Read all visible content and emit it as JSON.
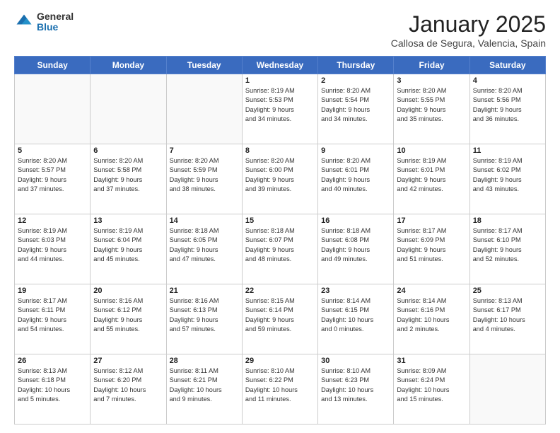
{
  "header": {
    "logo_general": "General",
    "logo_blue": "Blue",
    "month_title": "January 2025",
    "location": "Callosa de Segura, Valencia, Spain"
  },
  "days_of_week": [
    "Sunday",
    "Monday",
    "Tuesday",
    "Wednesday",
    "Thursday",
    "Friday",
    "Saturday"
  ],
  "weeks": [
    [
      {
        "day": "",
        "info": ""
      },
      {
        "day": "",
        "info": ""
      },
      {
        "day": "",
        "info": ""
      },
      {
        "day": "1",
        "info": "Sunrise: 8:19 AM\nSunset: 5:53 PM\nDaylight: 9 hours\nand 34 minutes."
      },
      {
        "day": "2",
        "info": "Sunrise: 8:20 AM\nSunset: 5:54 PM\nDaylight: 9 hours\nand 34 minutes."
      },
      {
        "day": "3",
        "info": "Sunrise: 8:20 AM\nSunset: 5:55 PM\nDaylight: 9 hours\nand 35 minutes."
      },
      {
        "day": "4",
        "info": "Sunrise: 8:20 AM\nSunset: 5:56 PM\nDaylight: 9 hours\nand 36 minutes."
      }
    ],
    [
      {
        "day": "5",
        "info": "Sunrise: 8:20 AM\nSunset: 5:57 PM\nDaylight: 9 hours\nand 37 minutes."
      },
      {
        "day": "6",
        "info": "Sunrise: 8:20 AM\nSunset: 5:58 PM\nDaylight: 9 hours\nand 37 minutes."
      },
      {
        "day": "7",
        "info": "Sunrise: 8:20 AM\nSunset: 5:59 PM\nDaylight: 9 hours\nand 38 minutes."
      },
      {
        "day": "8",
        "info": "Sunrise: 8:20 AM\nSunset: 6:00 PM\nDaylight: 9 hours\nand 39 minutes."
      },
      {
        "day": "9",
        "info": "Sunrise: 8:20 AM\nSunset: 6:01 PM\nDaylight: 9 hours\nand 40 minutes."
      },
      {
        "day": "10",
        "info": "Sunrise: 8:19 AM\nSunset: 6:01 PM\nDaylight: 9 hours\nand 42 minutes."
      },
      {
        "day": "11",
        "info": "Sunrise: 8:19 AM\nSunset: 6:02 PM\nDaylight: 9 hours\nand 43 minutes."
      }
    ],
    [
      {
        "day": "12",
        "info": "Sunrise: 8:19 AM\nSunset: 6:03 PM\nDaylight: 9 hours\nand 44 minutes."
      },
      {
        "day": "13",
        "info": "Sunrise: 8:19 AM\nSunset: 6:04 PM\nDaylight: 9 hours\nand 45 minutes."
      },
      {
        "day": "14",
        "info": "Sunrise: 8:18 AM\nSunset: 6:05 PM\nDaylight: 9 hours\nand 47 minutes."
      },
      {
        "day": "15",
        "info": "Sunrise: 8:18 AM\nSunset: 6:07 PM\nDaylight: 9 hours\nand 48 minutes."
      },
      {
        "day": "16",
        "info": "Sunrise: 8:18 AM\nSunset: 6:08 PM\nDaylight: 9 hours\nand 49 minutes."
      },
      {
        "day": "17",
        "info": "Sunrise: 8:17 AM\nSunset: 6:09 PM\nDaylight: 9 hours\nand 51 minutes."
      },
      {
        "day": "18",
        "info": "Sunrise: 8:17 AM\nSunset: 6:10 PM\nDaylight: 9 hours\nand 52 minutes."
      }
    ],
    [
      {
        "day": "19",
        "info": "Sunrise: 8:17 AM\nSunset: 6:11 PM\nDaylight: 9 hours\nand 54 minutes."
      },
      {
        "day": "20",
        "info": "Sunrise: 8:16 AM\nSunset: 6:12 PM\nDaylight: 9 hours\nand 55 minutes."
      },
      {
        "day": "21",
        "info": "Sunrise: 8:16 AM\nSunset: 6:13 PM\nDaylight: 9 hours\nand 57 minutes."
      },
      {
        "day": "22",
        "info": "Sunrise: 8:15 AM\nSunset: 6:14 PM\nDaylight: 9 hours\nand 59 minutes."
      },
      {
        "day": "23",
        "info": "Sunrise: 8:14 AM\nSunset: 6:15 PM\nDaylight: 10 hours\nand 0 minutes."
      },
      {
        "day": "24",
        "info": "Sunrise: 8:14 AM\nSunset: 6:16 PM\nDaylight: 10 hours\nand 2 minutes."
      },
      {
        "day": "25",
        "info": "Sunrise: 8:13 AM\nSunset: 6:17 PM\nDaylight: 10 hours\nand 4 minutes."
      }
    ],
    [
      {
        "day": "26",
        "info": "Sunrise: 8:13 AM\nSunset: 6:18 PM\nDaylight: 10 hours\nand 5 minutes."
      },
      {
        "day": "27",
        "info": "Sunrise: 8:12 AM\nSunset: 6:20 PM\nDaylight: 10 hours\nand 7 minutes."
      },
      {
        "day": "28",
        "info": "Sunrise: 8:11 AM\nSunset: 6:21 PM\nDaylight: 10 hours\nand 9 minutes."
      },
      {
        "day": "29",
        "info": "Sunrise: 8:10 AM\nSunset: 6:22 PM\nDaylight: 10 hours\nand 11 minutes."
      },
      {
        "day": "30",
        "info": "Sunrise: 8:10 AM\nSunset: 6:23 PM\nDaylight: 10 hours\nand 13 minutes."
      },
      {
        "day": "31",
        "info": "Sunrise: 8:09 AM\nSunset: 6:24 PM\nDaylight: 10 hours\nand 15 minutes."
      },
      {
        "day": "",
        "info": ""
      }
    ]
  ]
}
